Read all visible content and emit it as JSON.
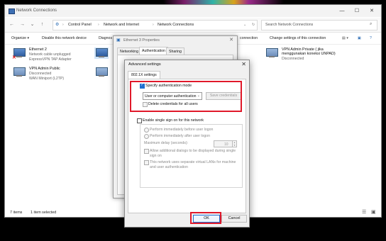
{
  "window": {
    "title": "Network Connections",
    "controls": {
      "minimize": "—",
      "maximize": "☐",
      "close": "✕"
    }
  },
  "nav": {
    "breadcrumb": [
      "Control Panel",
      "Network and Internet",
      "Network Connections"
    ],
    "search_placeholder": "Search Network Connections"
  },
  "commands": {
    "organize": "Organize ▾",
    "disable": "Disable this network device",
    "diagnose": "Diagnos",
    "connection": "connection",
    "change": "Change settings of this connection"
  },
  "connections": [
    {
      "name": "Ethernet 2",
      "status": "Network cable unplugged",
      "device": "ExpressVPN TAP Adapter"
    },
    {
      "name": "VPN Admin Public",
      "status": "Disconnected",
      "device": "WAN Miniport (L2TP)"
    },
    {
      "name": "VPN Admin Private ( jika",
      "status": "menggunakan koneksi UNPAD)",
      "device": "Disconnected"
    }
  ],
  "statusbar": {
    "items": "7 items",
    "selected": "1 item selected"
  },
  "properties": {
    "title": "Ethernet 3 Properties",
    "tabs": [
      "Networking",
      "Authentication",
      "Sharing"
    ],
    "active_tab": "Authentication"
  },
  "advanced": {
    "title": "Advanced settings",
    "tab": "802.1X settings",
    "specify_auth": "Specify authentication mode",
    "auth_mode": "User or computer authentication",
    "save_credentials": "Save credentials",
    "delete_credentials": "Delete credentials for all users",
    "sso": "Enable single sign on for this network",
    "before_logon": "Perform immediately before user logon",
    "after_logon": "Perform immediately after user logon",
    "max_delay": "Maximum delay (seconds):",
    "max_delay_value": "10",
    "allow_dialogs": "Allow additional dialogs to be displayed during single sign on",
    "separate_vlans": "This network uses separate virtual LANs for machine and user authentication",
    "ok": "OK",
    "cancel": "Cancel"
  },
  "colors": {
    "accent": "#1f6fd1",
    "highlight": "#e0192a"
  }
}
